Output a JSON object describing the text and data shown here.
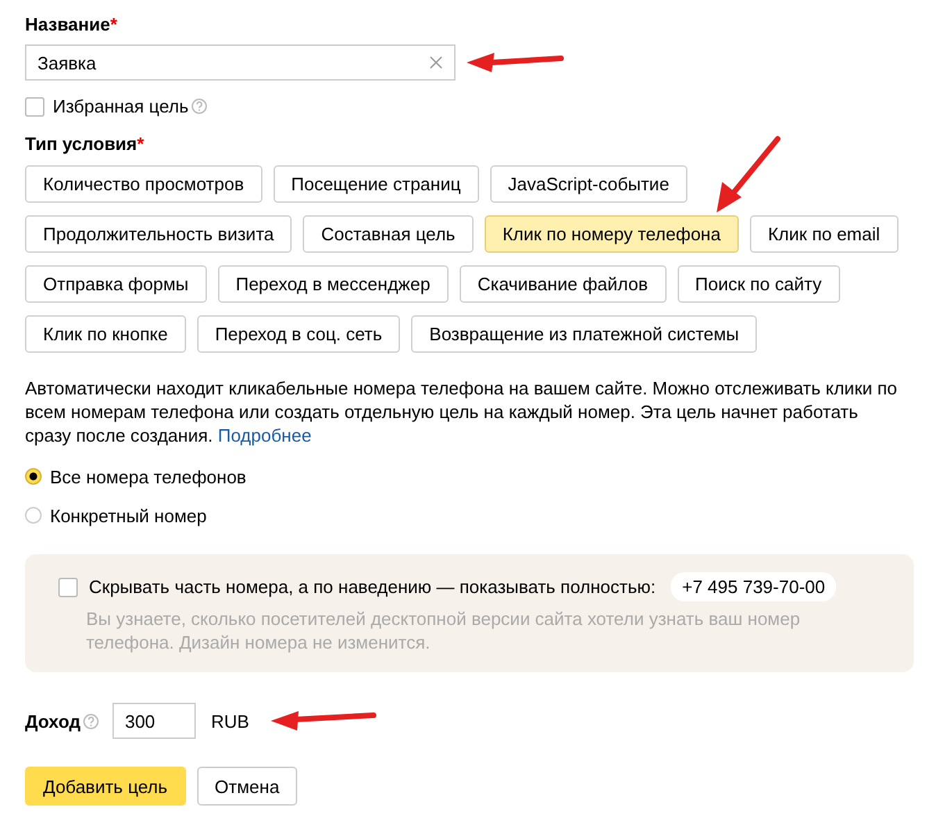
{
  "name_field": {
    "label": "Название",
    "required_mark": "*",
    "value": "Заявка"
  },
  "favorite": {
    "label": "Избранная цель",
    "checked": false
  },
  "condition": {
    "label": "Тип условия",
    "required_mark": "*",
    "types": [
      {
        "label": "Количество просмотров",
        "selected": false
      },
      {
        "label": "Посещение страниц",
        "selected": false
      },
      {
        "label": "JavaScript-событие",
        "selected": false
      },
      {
        "label": "Продолжительность визита",
        "selected": false
      },
      {
        "label": "Составная цель",
        "selected": false
      },
      {
        "label": "Клик по номеру телефона",
        "selected": true
      },
      {
        "label": "Клик по email",
        "selected": false
      },
      {
        "label": "Отправка формы",
        "selected": false
      },
      {
        "label": "Переход в мессенджер",
        "selected": false
      },
      {
        "label": "Скачивание файлов",
        "selected": false
      },
      {
        "label": "Поиск по сайту",
        "selected": false
      },
      {
        "label": "Клик по кнопке",
        "selected": false
      },
      {
        "label": "Переход в соц. сеть",
        "selected": false
      },
      {
        "label": "Возвращение из платежной системы",
        "selected": false
      }
    ]
  },
  "description": {
    "text": "Автоматически находит кликабельные номера телефона на вашем сайте. Можно отслеживать клики по всем номерам телефона или создать отдельную цель на каждый номер. Эта цель начнет работать сразу после создания.",
    "link": "Подробнее"
  },
  "scope": [
    {
      "label": "Все номера телефонов",
      "selected": true
    },
    {
      "label": "Конкретный номер",
      "selected": false
    }
  ],
  "hide_number": {
    "label": "Скрывать часть номера, а по наведению — показывать полностью:",
    "phone": "+7 495 739-70-00",
    "checked": false,
    "hint": "Вы узнаете, сколько посетителей десктопной версии сайта хотели узнать ваш номер телефона. Дизайн номера не изменится."
  },
  "revenue": {
    "label": "Доход",
    "value": "300",
    "currency": "RUB"
  },
  "buttons": [
    {
      "label": "Добавить цель",
      "kind": "primary"
    },
    {
      "label": "Отмена",
      "kind": "secondary"
    }
  ]
}
